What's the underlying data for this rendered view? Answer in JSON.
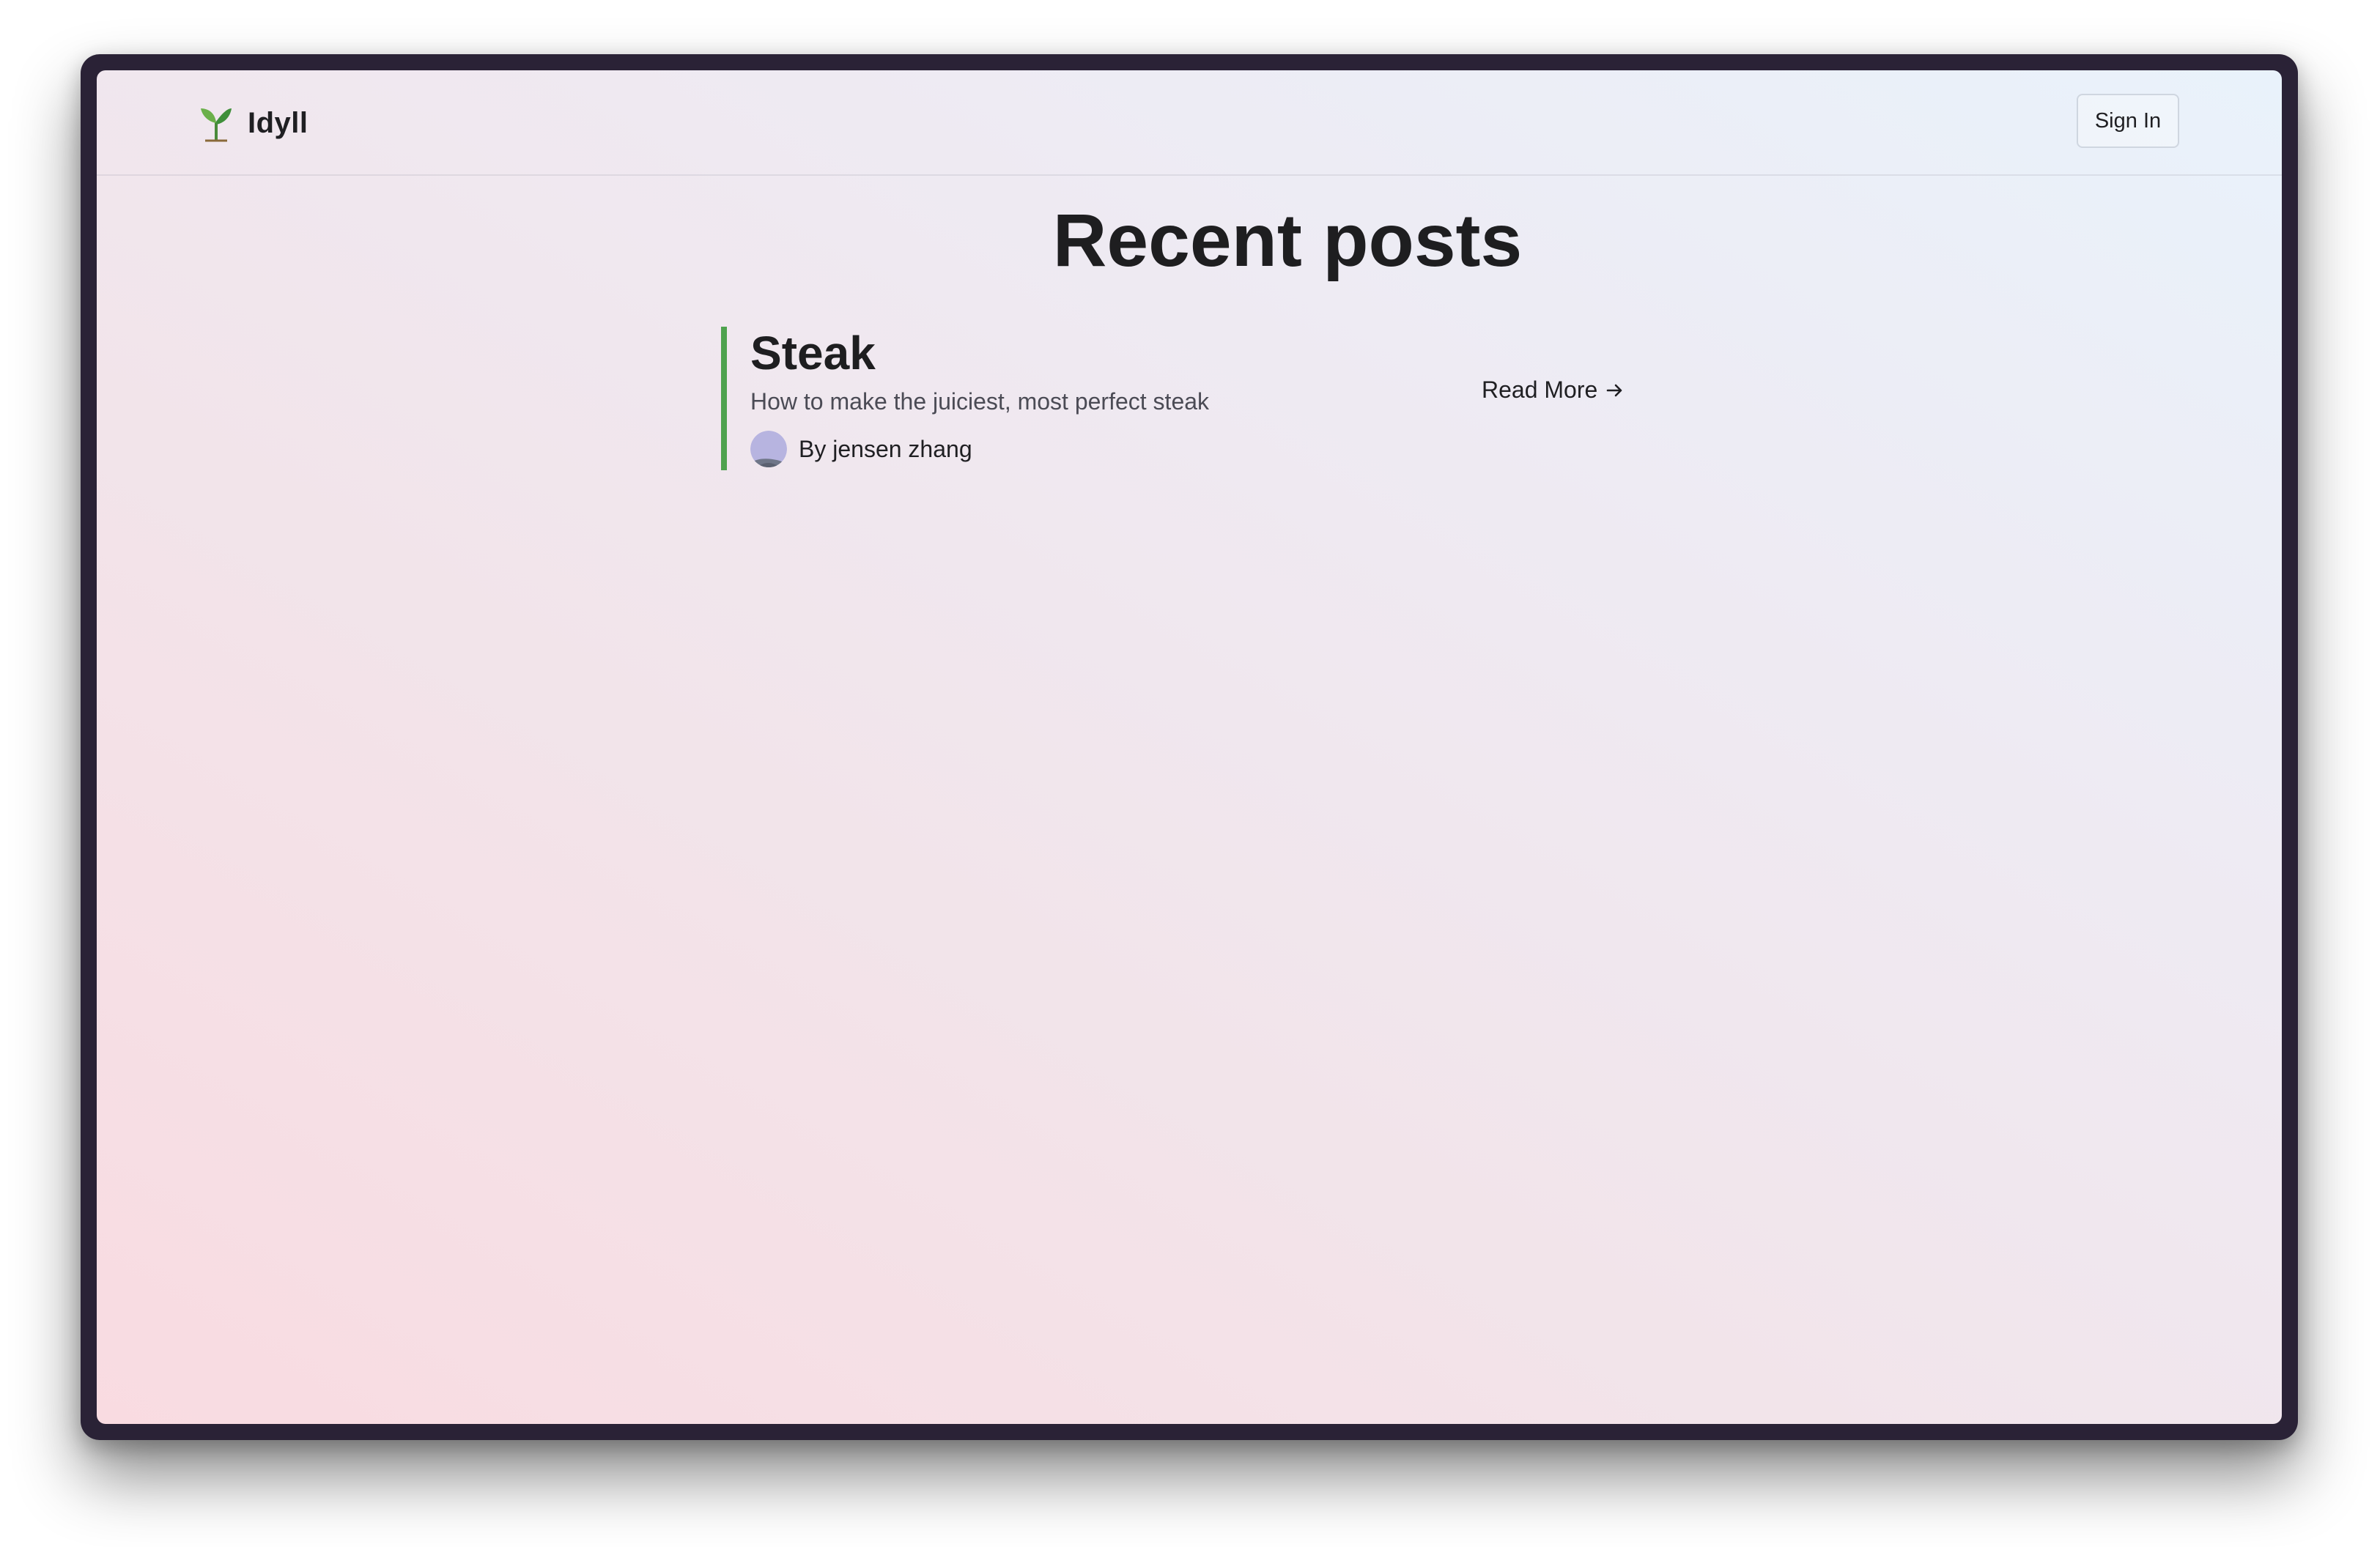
{
  "app": {
    "name": "Idyll",
    "logo_icon": "sprout-icon"
  },
  "header": {
    "signin_label": "Sign In"
  },
  "main": {
    "title": "Recent posts",
    "posts": [
      {
        "title": "Steak",
        "description": "How to make the juiciest, most perfect steak",
        "author": "By jensen zhang",
        "read_more_label": "Read More",
        "read_more_icon": "arrow-right-icon",
        "accent_color": "#4ea24e"
      }
    ]
  }
}
